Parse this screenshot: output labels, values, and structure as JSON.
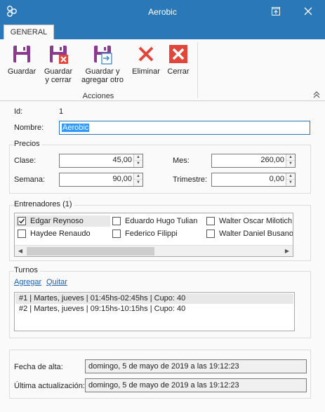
{
  "window": {
    "title": "Aerobic",
    "app_icon": "app-logo-icon",
    "restore_icon": "restore-window-icon",
    "close_icon": "close-icon",
    "accent_color": "#2b78b9"
  },
  "tabs": [
    {
      "label": "GENERAL",
      "active": true
    }
  ],
  "ribbon": {
    "buttons": [
      {
        "label": "Guardar",
        "icon": "save-icon"
      },
      {
        "label_line1": "Guardar",
        "label_line2": "y cerrar",
        "icon": "save-close-icon"
      },
      {
        "label_line1": "Guardar y",
        "label_line2": "agregar otro",
        "icon": "save-add-icon"
      },
      {
        "label": "Eliminar",
        "icon": "delete-x-icon"
      },
      {
        "label": "Cerrar",
        "icon": "close-box-icon"
      }
    ],
    "group_label": "Acciones"
  },
  "form": {
    "id_label": "Id:",
    "id_value": "1",
    "nombre_label": "Nombre:",
    "nombre_value": "Aerobic"
  },
  "precios": {
    "title": "Precios",
    "clase_label": "Clase:",
    "clase_value": "45,00",
    "mes_label": "Mes:",
    "mes_value": "260,00",
    "semana_label": "Semana:",
    "semana_value": "90,00",
    "trimestre_label": "Trimestre:",
    "trimestre_value": "0,00"
  },
  "entrenadores": {
    "title": "Entrenadores (1)",
    "items": [
      {
        "name": "Edgar Reynoso",
        "checked": true
      },
      {
        "name": "Haydee Renaudo",
        "checked": false
      },
      {
        "name": "Eduardo Hugo Tulian",
        "checked": false
      },
      {
        "name": "Federico Filippi",
        "checked": false
      },
      {
        "name": "Walter Oscar Milotich",
        "checked": false
      },
      {
        "name": "Walter Daniel Busano",
        "checked": false
      }
    ]
  },
  "turnos": {
    "title": "Turnos",
    "add_link": "Agregar",
    "remove_link": "Quitar",
    "rows": [
      "#1 | Martes, jueves | 01:45hs-02:45hs | Cupo: 40",
      "#2 | Martes, jueves | 09:15hs-10:15hs | Cupo: 40"
    ]
  },
  "fechas": {
    "alta_label": "Fecha de alta:",
    "alta_value": "domingo, 5 de mayo de 2019 a las 19:12:23",
    "actualizacion_label": "Última actualización:",
    "actualizacion_value": "domingo, 5 de mayo de 2019 a las 19:12:23"
  }
}
